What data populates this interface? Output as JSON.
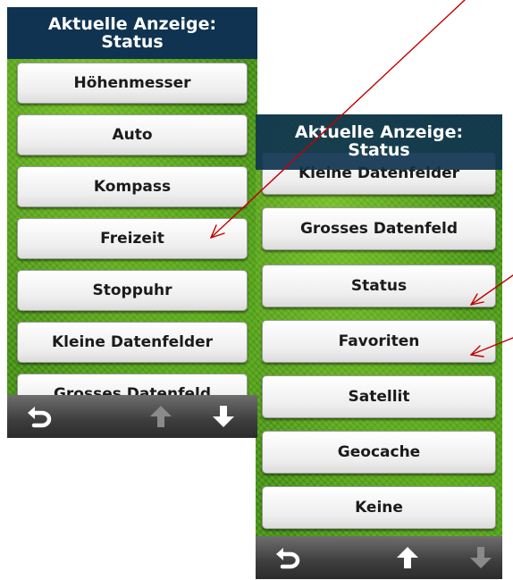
{
  "screen_left": {
    "header": {
      "line1": "Aktuelle Anzeige:",
      "line2": "Status"
    },
    "items": [
      "Höhenmesser",
      "Auto",
      "Kompass",
      "Freizeit",
      "Stoppuhr",
      "Kleine Datenfelder",
      "Grosses Datenfeld"
    ],
    "toolbar": {
      "back": "back-icon",
      "up": "up-arrow-icon",
      "up_state": "disabled",
      "down": "down-arrow-icon",
      "down_state": "enabled"
    }
  },
  "screen_right": {
    "header": {
      "line1": "Aktuelle Anzeige:",
      "line2": "Status"
    },
    "items": [
      "Kleine Datenfelder",
      "Grosses Datenfeld",
      "Status",
      "Favoriten",
      "Satellit",
      "Geocache",
      "Keine"
    ],
    "toolbar": {
      "back": "back-icon",
      "up": "up-arrow-icon",
      "up_state": "enabled",
      "down": "down-arrow-icon",
      "down_state": "disabled"
    }
  },
  "colors": {
    "header_bg": "#0f3350",
    "background_green": "#4a9a16",
    "annotation_arrow": "#c00000",
    "icon_enabled": "#ffffff",
    "icon_disabled": "#8a8a8a"
  }
}
